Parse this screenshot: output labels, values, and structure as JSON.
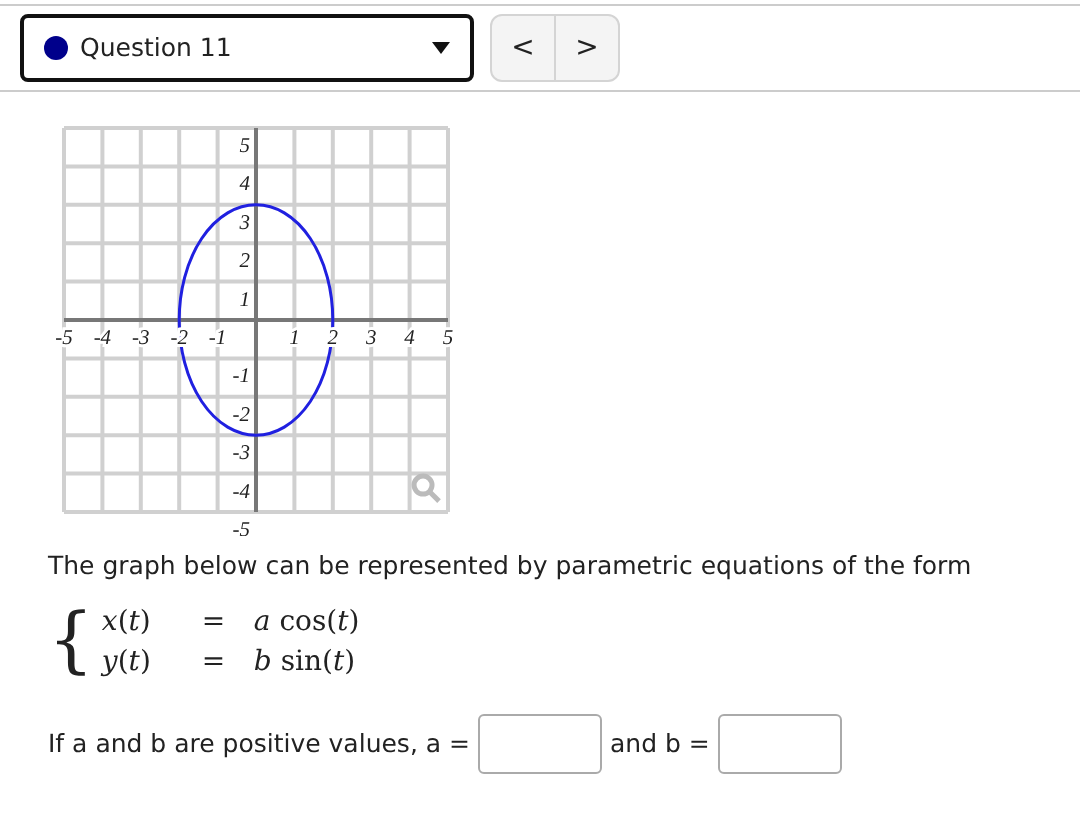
{
  "question_select": {
    "label": "Question 11",
    "color": "#00008b"
  },
  "nav_buttons": [
    "<",
    ">"
  ],
  "graph": {
    "chart_data": {
      "type": "line",
      "grid": true,
      "xlim": [
        -5,
        5
      ],
      "ylim": [
        -5,
        5
      ],
      "xticks": [
        -5,
        -4,
        -3,
        -2,
        -1,
        1,
        2,
        3,
        4,
        5
      ],
      "yticks": [
        -5,
        -4,
        -3,
        -2,
        -1,
        1,
        2,
        3,
        4,
        5
      ]
    }
  },
  "prompt": "The graph below can be represented by parametric equations of the form",
  "brace": "{",
  "equations": [
    {
      "lhs": "*x*(*t*)",
      "sign": "=",
      "rhs": "*a* cos(*t*)"
    },
    {
      "lhs": "*y*(*t*)",
      "sign": "=",
      "rhs": "*b* sin(*t*)"
    }
  ],
  "answer_row": [
    {
      "label": "If a and b are positive values, a ="
    },
    {
      "label": "and b ="
    }
  ]
}
